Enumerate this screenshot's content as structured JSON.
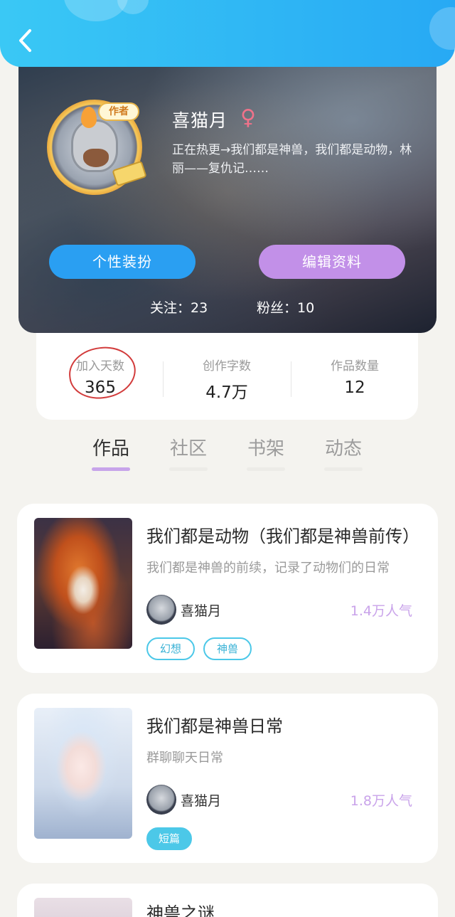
{
  "header": {
    "back_icon": "chevron-left-icon"
  },
  "profile": {
    "name": "喜猫月",
    "gender_symbol": "♀",
    "author_badge": "作者",
    "bio": "正在热更→我们都是神兽，我们都是动物，林丽——复仇记……",
    "dress_button": "个性装扮",
    "edit_button": "编辑资料",
    "following": "关注：23",
    "followers": "粉丝：10"
  },
  "stats": [
    {
      "label": "加入天数",
      "value": "365"
    },
    {
      "label": "创作字数",
      "value": "4.7万"
    },
    {
      "label": "作品数量",
      "value": "12"
    }
  ],
  "tabs": [
    {
      "label": "作品",
      "active": true
    },
    {
      "label": "社区",
      "active": false
    },
    {
      "label": "书架",
      "active": false
    },
    {
      "label": "动态",
      "active": false
    }
  ],
  "works": [
    {
      "title": "我们都是动物（我们都是神兽前传）",
      "desc": "我们都是神兽的前续，记录了动物们的日常",
      "author": "喜猫月",
      "popularity": "1.4万人气",
      "tags": [
        "幻想",
        "神兽"
      ]
    },
    {
      "title": "我们都是神兽日常",
      "desc": "群聊聊天日常",
      "author": "喜猫月",
      "popularity": "1.8万人气",
      "tags": [
        "短篇"
      ]
    },
    {
      "title": "神兽之谜"
    }
  ],
  "colors": {
    "header_blue": "#27a9f4",
    "dress_button": "#2a9ff2",
    "edit_button": "#c290e8",
    "tab_active_underline": "#c7a4ea",
    "popularity": "#c9a3ea",
    "tag": "#4cc8e8"
  }
}
